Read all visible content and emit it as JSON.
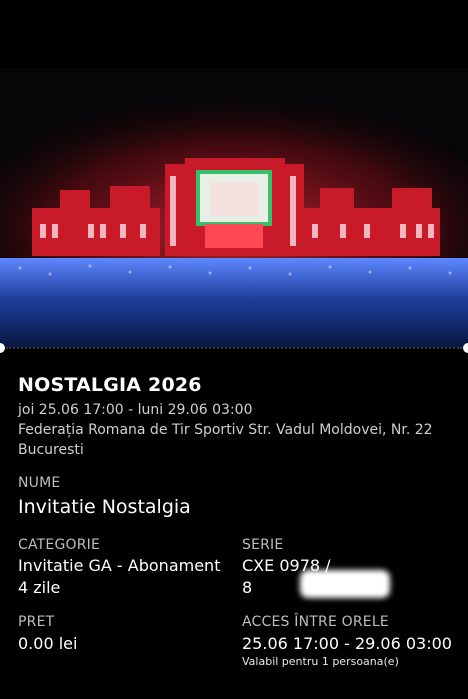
{
  "event": {
    "title": "NOSTALGIA 2026",
    "datetime": "joi 25.06 17:00 - luni 29.06 03:00",
    "venue": "Federația Romana de Tir Sportiv Str. Vadul Moldovei, Nr. 22 Bucuresti"
  },
  "fields": {
    "name_label": "NUME",
    "name_value": "Invitatie Nostalgia",
    "category_label": "CATEGORIE",
    "category_value_line1": "Invitatie GA - Abonament",
    "category_value_line2": "4 zile",
    "series_label": "SERIE",
    "series_value_line1": "CXE 0978 /",
    "series_value_line2": "8",
    "price_label": "PRET",
    "price_value": "0.00 lei",
    "access_label": "ACCES ÎNTRE ORELE",
    "access_value": "25.06 17:00 - 29.06 03:00",
    "access_note": "Valabil pentru 1 persoana(e)"
  },
  "colors": {
    "background": "#000000",
    "text": "#ffffff",
    "muted_text": "#bdbdbd",
    "stage_red": "#ff2a3a",
    "crowd_blue": "#2a5dd8"
  }
}
